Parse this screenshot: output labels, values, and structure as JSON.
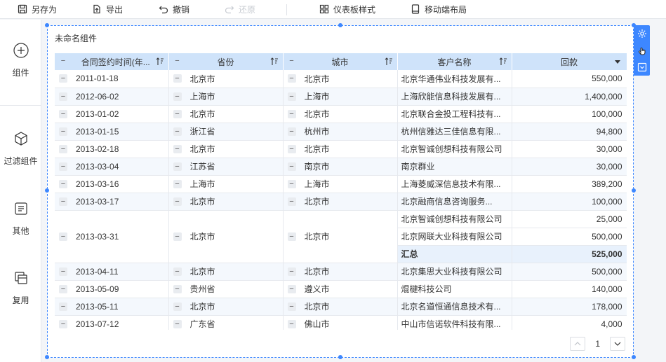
{
  "toolbar": {
    "save_as": "另存为",
    "export": "导出",
    "undo": "撤销",
    "redo": "还原",
    "dashboard_style": "仪表板样式",
    "mobile_layout": "移动端布局"
  },
  "sidebar": {
    "items": [
      {
        "label": "组件",
        "icon": "plus-circle-icon"
      },
      {
        "label": "过滤组件",
        "icon": "cube-icon"
      },
      {
        "label": "其他",
        "icon": "document-icon"
      },
      {
        "label": "复用",
        "icon": "copy-icon"
      }
    ]
  },
  "widget": {
    "title": "未命名组件",
    "columns": [
      "合同签约时间(年...",
      "省份",
      "城市",
      "客户名称",
      "回款"
    ],
    "rows": [
      {
        "date": "2011-01-18",
        "province": "北京市",
        "city": "北京市",
        "customer": "北京华通伟业科技发展有...",
        "amount": "550,000"
      },
      {
        "date": "2012-06-02",
        "province": "上海市",
        "city": "上海市",
        "customer": "上海欣能信息科技发展有...",
        "amount": "1,400,000"
      },
      {
        "date": "2013-01-02",
        "province": "北京市",
        "city": "北京市",
        "customer": "北京联合金投工程科技有...",
        "amount": "100,000"
      },
      {
        "date": "2013-01-15",
        "province": "浙江省",
        "city": "杭州市",
        "customer": "杭州信雅达三佳信息有限...",
        "amount": "94,800"
      },
      {
        "date": "2013-02-18",
        "province": "北京市",
        "city": "北京市",
        "customer": "北京智诚创想科技有限公司",
        "amount": "30,000"
      },
      {
        "date": "2013-03-04",
        "province": "江苏省",
        "city": "南京市",
        "customer": "南京群业",
        "amount": "30,000"
      },
      {
        "date": "2013-03-16",
        "province": "上海市",
        "city": "上海市",
        "customer": "上海菱威深信息技术有限...",
        "amount": "389,200"
      },
      {
        "date": "2013-03-17",
        "province": "北京市",
        "city": "北京市",
        "customer": "北京融商信息咨询服务...",
        "amount": "100,000"
      }
    ],
    "group": {
      "date": "2013-03-31",
      "province": "北京市",
      "city": "北京市",
      "items": [
        {
          "customer": "北京智诚创想科技有限公司",
          "amount": "25,000"
        },
        {
          "customer": "北京网联大业科技有限公司",
          "amount": "500,000"
        }
      ],
      "total_label": "汇总",
      "total_amount": "525,000"
    },
    "rows2": [
      {
        "date": "2013-04-11",
        "province": "北京市",
        "city": "北京市",
        "customer": "北京集思大业科技有限公司",
        "amount": "500,000"
      },
      {
        "date": "2013-05-09",
        "province": "贵州省",
        "city": "遵义市",
        "customer": "焜楗科技公司",
        "amount": "140,000"
      },
      {
        "date": "2013-05-11",
        "province": "北京市",
        "city": "北京市",
        "customer": "北京名道恒通信息技术有...",
        "amount": "178,000"
      },
      {
        "date": "2013-07-12",
        "province": "广东省",
        "city": "佛山市",
        "customer": "中山市信诺软件科技有限...",
        "amount": "4,000"
      }
    ],
    "page": "1"
  },
  "colors": {
    "accent": "#3d87ff",
    "header_bg": "#cfe3fa",
    "row_alt": "#f4f8fd"
  }
}
